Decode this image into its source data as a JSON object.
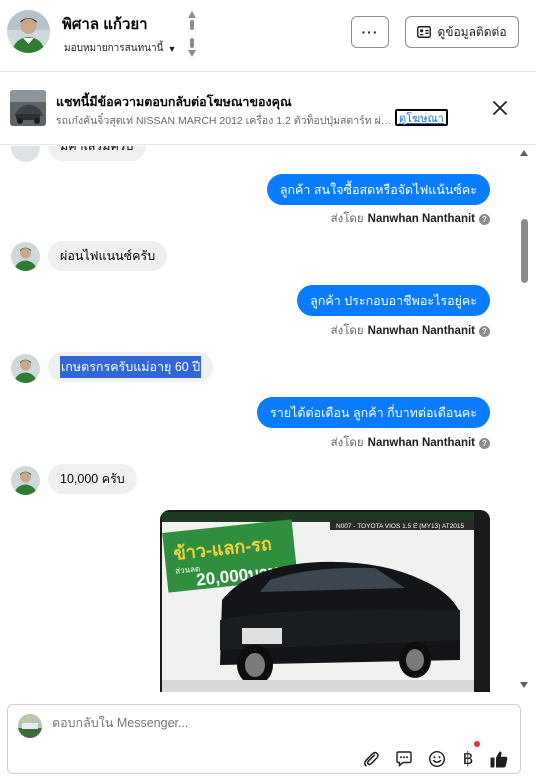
{
  "header": {
    "name": "พิศาล แก้วยา",
    "assigned_label": "มอบหมายการสนทนานี้",
    "more_label": "···",
    "contact_label": "ดูข้อมูลติดต่อ"
  },
  "ad": {
    "title": "แชทนี้มีข้อความตอบกลับต่อโฆษณาของคุณ",
    "subtitle": "รถเก๋งคันจิ๋วสุดเท่ NISSAN MARCH 2012 เครื่อง 1.2 ตัวท็อปปุ่มสตาร์ท ผ่อ...",
    "link_label": "ดูโฆษณา"
  },
  "messages": {
    "partial_in": "มีค่าเสริมครับ",
    "out_1": "ลูกค้า สนใจซื้อสดหรือจัดไฟแน้นซ์คะ",
    "sent_by_label": "ส่งโดย",
    "sender_name": "Nanwhan Nanthanit",
    "in_1": "ผ่อนไฟแนนซ์ครับ",
    "out_2": "ลูกค้า ประกอบอาชีพอะไรอยู่คะ",
    "in_2": "เกษตรกรครับแม่อายุ 60 ปี",
    "out_3": "รายได้ต่อเดือน ลูกค้า กี่บาทต่อเดือนคะ",
    "in_3": "10,000 ครับ"
  },
  "photo": {
    "promo_text": "ข้าว-แลก-รถ",
    "discount_label": "ส่วนลด",
    "discount_value": "20,000บาท",
    "model_text": "N007 - TOYOTA VIOS 1.5 E (MY13) AT2015"
  },
  "composer": {
    "placeholder": "ตอบกลับใน Messenger..."
  },
  "colors": {
    "accent": "#0a7cff",
    "incoming_bubble": "#f0f0f0",
    "notification": "#f02849"
  },
  "icons": [
    "up-down-icon",
    "more-icon",
    "contact-card-icon",
    "close-icon",
    "help-icon",
    "paperclip-icon",
    "speech-bubble-icon",
    "smiley-icon",
    "baht-icon",
    "thumbs-up-icon"
  ]
}
